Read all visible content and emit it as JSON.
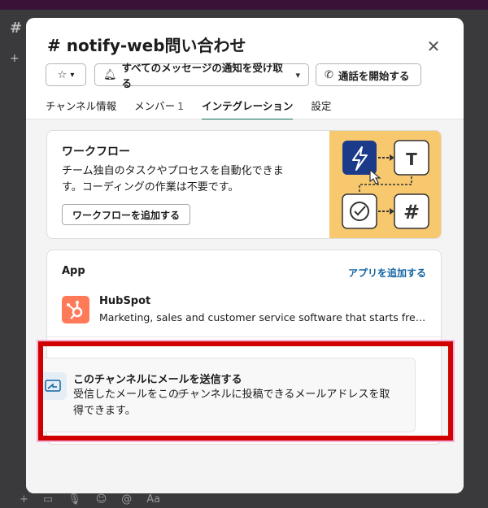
{
  "background": {
    "channel_hash": "#",
    "plus": "+",
    "toolbar_text": "Aa"
  },
  "modal": {
    "title": "# notify-web問い合わせ",
    "close_icon": "close-icon",
    "star_icon": "star-icon",
    "notify_label": "すべてのメッセージの通知を受け取る",
    "bell_icon": "bell-icon",
    "call_label": "通話を開始する",
    "phone_icon": "phone-icon",
    "tabs": [
      {
        "label": "チャンネル情報"
      },
      {
        "label": "メンバー",
        "count": "1"
      },
      {
        "label": "インテグレーション",
        "active": true
      },
      {
        "label": "設定"
      }
    ]
  },
  "workflow": {
    "title": "ワークフロー",
    "description": "チーム独自のタスクやプロセスを自動化できます。コーディングの作業は不要です。",
    "button": "ワークフローを追加する",
    "illustration_color": "#f7c86e"
  },
  "apps": {
    "section_title": "App",
    "add_link": "アプリを追加する",
    "items": [
      {
        "name": "HubSpot",
        "description": "Marketing, sales and customer service software that starts free t..."
      }
    ]
  },
  "email_integration": {
    "title": "このチャンネルにメールを送信する",
    "description": "受信したメールをこのチャンネルに投稿できるメールアドレスを取得できます。"
  },
  "colors": {
    "accent_tab": "#126b5c",
    "link": "#1264a3",
    "highlight": "#d10000",
    "hubspot": "#ff7a59"
  }
}
